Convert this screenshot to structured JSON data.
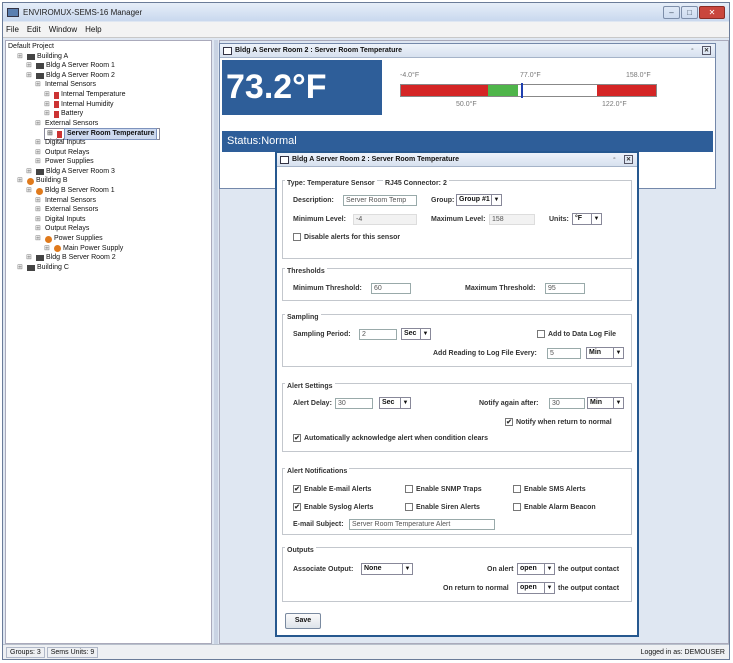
{
  "app": {
    "title": "ENVIROMUX-SEMS-16 Manager",
    "menu": [
      "File",
      "Edit",
      "Window",
      "Help"
    ]
  },
  "tree": [
    {
      "label": "Default Project",
      "icon": "",
      "indent": 0
    },
    {
      "label": "Building A",
      "icon": "bldg",
      "indent": 1
    },
    {
      "label": "Bldg A Server Room 1",
      "icon": "bldg",
      "indent": 2
    },
    {
      "label": "Bldg A Server Room 2",
      "icon": "bldg",
      "indent": 2
    },
    {
      "label": "Internal Sensors",
      "icon": "",
      "indent": 3
    },
    {
      "label": "Internal Temperature",
      "icon": "sens",
      "indent": 4
    },
    {
      "label": "Internal Humidity",
      "icon": "sens",
      "indent": 4
    },
    {
      "label": "Battery",
      "icon": "sens",
      "indent": 4
    },
    {
      "label": "External Sensors",
      "icon": "",
      "indent": 3
    },
    {
      "label": "Server Room Temperature",
      "icon": "sens",
      "indent": 4,
      "selected": true
    },
    {
      "label": "Digital Inputs",
      "icon": "",
      "indent": 3
    },
    {
      "label": "Output Relays",
      "icon": "",
      "indent": 3
    },
    {
      "label": "Power Supplies",
      "icon": "",
      "indent": 3
    },
    {
      "label": "Bldg A Server Room 3",
      "icon": "bldg",
      "indent": 2
    },
    {
      "label": "Building B",
      "icon": "warn",
      "indent": 1
    },
    {
      "label": "Bldg B Server Room 1",
      "icon": "warn",
      "indent": 2
    },
    {
      "label": "Internal Sensors",
      "icon": "",
      "indent": 3
    },
    {
      "label": "External Sensors",
      "icon": "",
      "indent": 3
    },
    {
      "label": "Digital Inputs",
      "icon": "",
      "indent": 3
    },
    {
      "label": "Output Relays",
      "icon": "",
      "indent": 3
    },
    {
      "label": "Power Supplies",
      "icon": "warn",
      "indent": 3
    },
    {
      "label": "Main Power Supply",
      "icon": "warn",
      "indent": 4
    },
    {
      "label": "Bldg B Server Room 2",
      "icon": "bldg",
      "indent": 2
    },
    {
      "label": "Building C",
      "icon": "bldg",
      "indent": 1
    }
  ],
  "status_bar": {
    "groups": "Groups: 3",
    "units": "Sems Units: 9",
    "login": "Logged in as: DEMOUSER"
  },
  "monitor": {
    "title": "Bldg A Server Room 2 : Server Room Temperature",
    "value": "73.2°F",
    "status": "Status:Normal",
    "gauge_labels_top": [
      "-4.0°F",
      "77.0°F",
      "158.0°F"
    ],
    "gauge_labels_bottom": [
      "50.0°F",
      "122.0°F"
    ],
    "gauge_value_fraction": 0.47
  },
  "dialog": {
    "title": "Bldg A Server Room 2 : Server Room Temperature",
    "type_label": "Type: Temperature Sensor",
    "connector_label": "RJ45 Connector: 2",
    "description_label": "Description:",
    "description_value": "Server Room Temp",
    "group_label": "Group:",
    "group_value": "Group #1",
    "min_level_label": "Minimum Level:",
    "min_level_value": "-4",
    "max_level_label": "Maximum Level:",
    "max_level_value": "158",
    "units_label": "Units:",
    "units_value": "°F",
    "disable_alerts": "Disable alerts for this sensor",
    "thresholds_header": "Thresholds",
    "min_threshold_label": "Minimum Threshold:",
    "min_threshold_value": "60",
    "max_threshold_label": "Maximum Threshold:",
    "max_threshold_value": "95",
    "sampling_header": "Sampling",
    "sampling_period_label": "Sampling Period:",
    "sampling_period_value": "2",
    "sampling_unit": "Sec",
    "add_data_log": "Add to Data Log File",
    "log_every_label": "Add Reading to Log File Every:",
    "log_every_value": "5",
    "log_every_unit": "Min",
    "alert_settings_header": "Alert Settings",
    "alert_delay_label": "Alert Delay:",
    "alert_delay_value": "30",
    "alert_delay_unit": "Sec",
    "notify_again_label": "Notify again after:",
    "notify_again_value": "30",
    "notify_again_unit": "Min",
    "notify_return": "Notify when return to normal",
    "auto_ack": "Automatically acknowledge alert when condition clears",
    "notifications_header": "Alert Notifications",
    "enable_email": "Enable E-mail Alerts",
    "enable_snmp": "Enable SNMP Traps",
    "enable_sms": "Enable SMS Alerts",
    "enable_syslog": "Enable Syslog Alerts",
    "enable_siren": "Enable Siren Alerts",
    "enable_beacon": "Enable Alarm Beacon",
    "email_subject_label": "E-mail Subject:",
    "email_subject_value": "Server Room Temperature Alert",
    "outputs_header": "Outputs",
    "assoc_output_label": "Associate Output:",
    "assoc_output_value": "None",
    "on_alert_label": "On alert",
    "on_alert_value": "open",
    "on_return_label": "On return to normal",
    "on_return_value": "open",
    "output_contact_text": "the output contact",
    "save_label": "Save"
  },
  "colors": {
    "accent": "#2e5e99",
    "gauge_red": "#d42525",
    "gauge_green": "#4fb54a",
    "gauge_marker": "#1f3fb0"
  }
}
